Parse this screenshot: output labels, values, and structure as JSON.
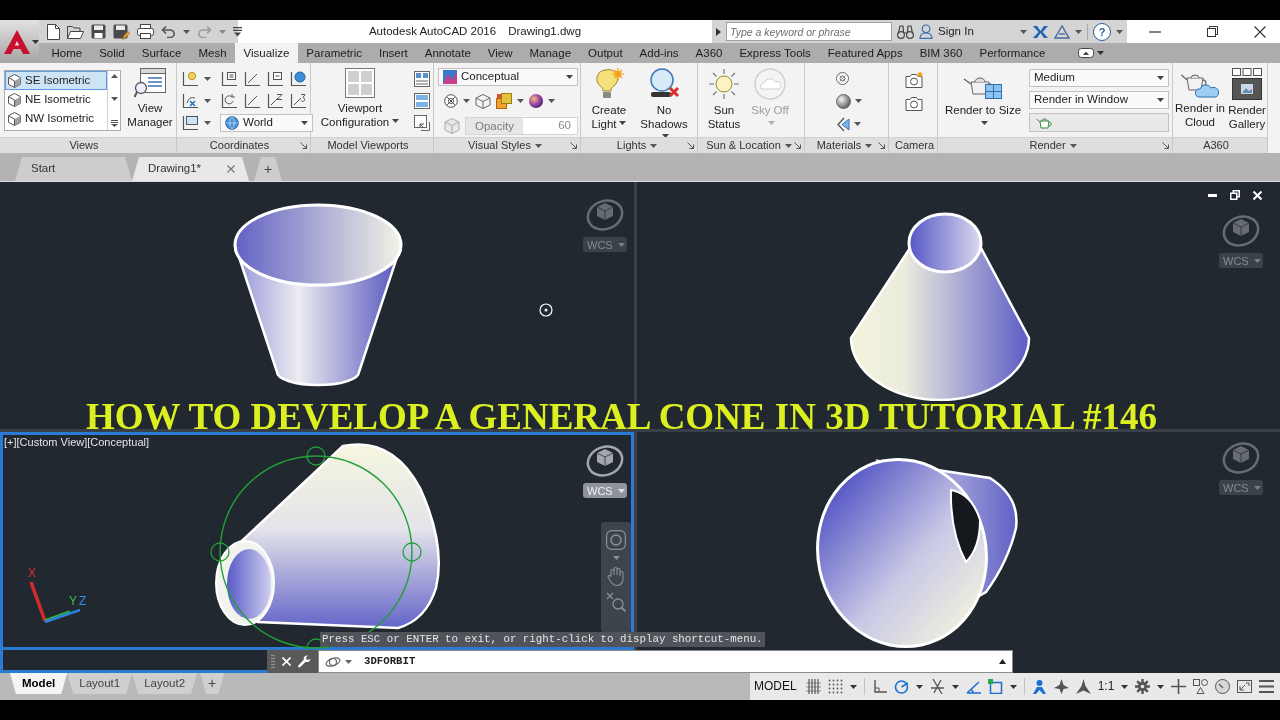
{
  "title_bar": {
    "app_title": "Autodesk AutoCAD 2016",
    "file_name": "Drawing1.dwg",
    "search": {
      "placeholder": "Type a keyword or phrase"
    },
    "sign_in": "Sign In",
    "help": "?"
  },
  "ribbon_tabs": [
    {
      "label": "Home",
      "selected": false
    },
    {
      "label": "Solid",
      "selected": false
    },
    {
      "label": "Surface",
      "selected": false
    },
    {
      "label": "Mesh",
      "selected": false
    },
    {
      "label": "Visualize",
      "selected": true
    },
    {
      "label": "Parametric",
      "selected": false
    },
    {
      "label": "Insert",
      "selected": false
    },
    {
      "label": "Annotate",
      "selected": false
    },
    {
      "label": "View",
      "selected": false
    },
    {
      "label": "Manage",
      "selected": false
    },
    {
      "label": "Output",
      "selected": false
    },
    {
      "label": "Add-ins",
      "selected": false
    },
    {
      "label": "A360",
      "selected": false
    },
    {
      "label": "Express Tools",
      "selected": false
    },
    {
      "label": "Featured Apps",
      "selected": false
    },
    {
      "label": "BIM 360",
      "selected": false
    },
    {
      "label": "Performance",
      "selected": false
    }
  ],
  "ribbon_panels": [
    {
      "kind": "views",
      "title": "Views",
      "views": [
        {
          "label": "SE Isometric",
          "selected": true
        },
        {
          "label": "NE Isometric",
          "selected": false
        },
        {
          "label": "NW Isometric",
          "selected": false
        }
      ],
      "button": {
        "label": "View Manager",
        "menu": false
      }
    },
    {
      "kind": "coordinates",
      "title": "Coordinates",
      "launcher": true,
      "ucs": "World"
    },
    {
      "kind": "viewports",
      "title": "Model Viewports",
      "button": {
        "label": "Viewport Configuration",
        "menu": true
      }
    },
    {
      "kind": "visual_styles",
      "title": "Visual Styles",
      "expander": true,
      "launcher": true,
      "style": "Conceptual",
      "opacity": {
        "label": "Opacity",
        "value": "60",
        "disabled": true
      }
    },
    {
      "kind": "lights",
      "title": "Lights",
      "expander": true,
      "launcher": true,
      "buttons": [
        {
          "label": "Create Light",
          "menu": true,
          "disabled": false
        },
        {
          "label": "No Shadows",
          "menu": true,
          "disabled": false
        }
      ]
    },
    {
      "kind": "sun_location",
      "title": "Sun & Location",
      "expander": true,
      "launcher": true,
      "buttons": [
        {
          "label": "Sun Status",
          "menu": false,
          "disabled": false
        },
        {
          "label": "Sky Off",
          "menu": true,
          "disabled": true
        }
      ]
    },
    {
      "kind": "materials",
      "title": "Materials",
      "expander": true,
      "launcher": true
    },
    {
      "kind": "camera",
      "title": "Camera"
    },
    {
      "kind": "render",
      "title": "Render",
      "expander": true,
      "launcher": true,
      "button": {
        "label": "Render to Size",
        "menu": true
      },
      "preset": "Medium",
      "target": "Render in Window",
      "progress": {
        "level": 0
      }
    },
    {
      "kind": "a360",
      "title": "A360",
      "buttons": [
        {
          "label": "Render in Cloud",
          "menu": false,
          "disabled": false
        },
        {
          "label": "Render Gallery",
          "menu": false,
          "disabled": false
        }
      ]
    }
  ],
  "file_tabs": [
    {
      "label": "Start",
      "selected": false,
      "closable": false
    },
    {
      "label": "Drawing1*",
      "selected": true,
      "closable": true
    }
  ],
  "new_tab": "+",
  "viewports": [
    {
      "active": false,
      "wcs": "WCS",
      "cursor": true
    },
    {
      "active": false,
      "wcs": "WCS",
      "window_controls": true
    },
    {
      "active": true,
      "label": "[+][Custom View][Conceptual]",
      "wcs": "WCS",
      "orbit": true,
      "nav_bar": true,
      "ucs_labels": [
        "X",
        "Y",
        "Z"
      ]
    },
    {
      "active": false,
      "wcs": "WCS"
    }
  ],
  "caption": "HOW TO DEVELOP A GENERAL CONE IN 3D TUTORIAL #146",
  "command_line": {
    "prompt": "Press ESC or ENTER to exit, or right-click to display shortcut-menu.",
    "command": "3DFORBIT"
  },
  "layout_tabs": [
    {
      "label": "Model",
      "selected": true
    },
    {
      "label": "Layout1",
      "selected": false
    },
    {
      "label": "Layout2",
      "selected": false
    }
  ],
  "new_layout": "+",
  "status_bar": {
    "space": "MODEL",
    "items": [
      {
        "kind": "grid",
        "on": false
      },
      {
        "kind": "snap",
        "on": false,
        "menu": true
      },
      {
        "kind": "ortho",
        "on": false
      },
      {
        "kind": "polar",
        "on": true,
        "menu": true
      },
      {
        "kind": "isodraft",
        "on": false,
        "menu": true
      },
      {
        "kind": "tracking",
        "on": true
      },
      {
        "kind": "osnap",
        "on": true,
        "menu": true
      },
      {
        "kind": "annovis",
        "on": true
      },
      {
        "kind": "autoscale",
        "on": false
      },
      {
        "kind": "annoscale"
      },
      {
        "kind": "scale",
        "label": "1:1",
        "menu": true
      },
      {
        "kind": "workspace",
        "menu": true
      },
      {
        "kind": "plus"
      },
      {
        "kind": "isolate"
      },
      {
        "kind": "hardware"
      },
      {
        "kind": "cleanscreen"
      },
      {
        "kind": "customize"
      }
    ]
  }
}
